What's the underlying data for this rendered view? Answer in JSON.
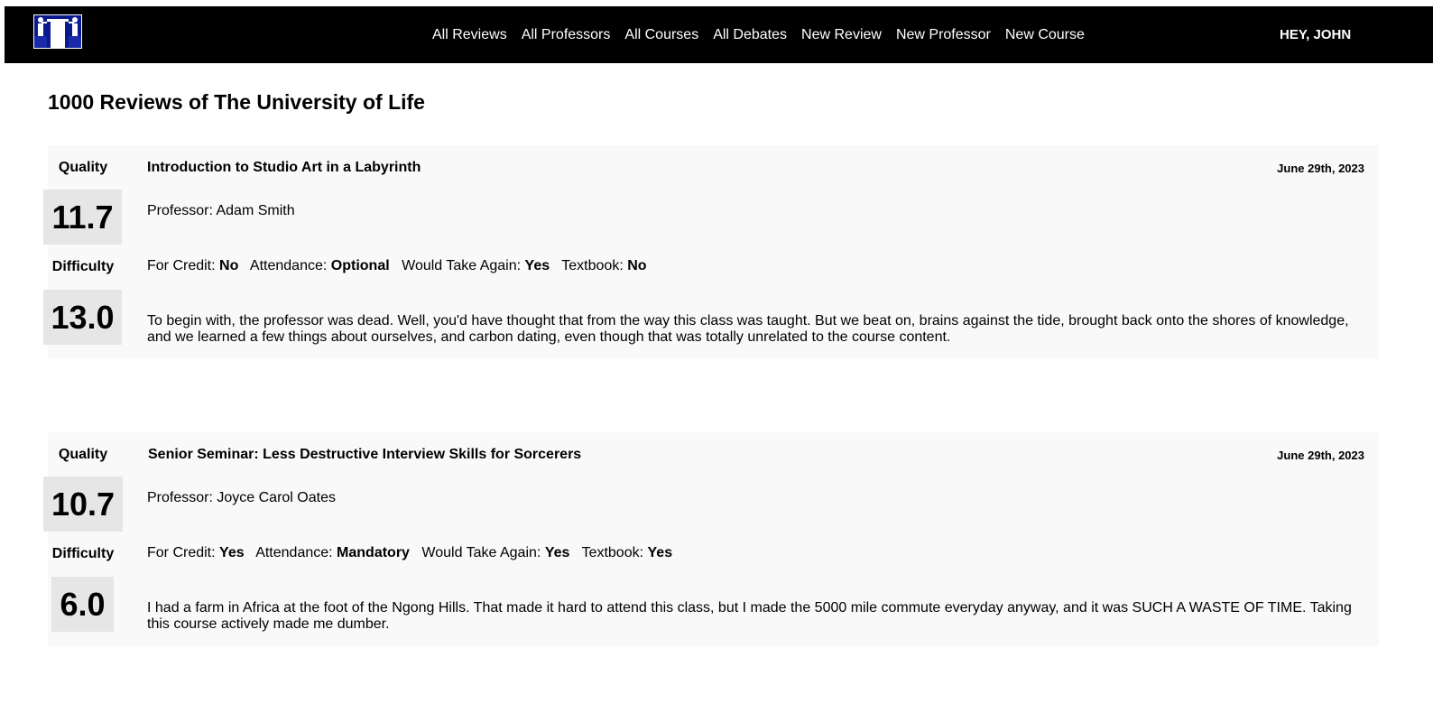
{
  "nav": {
    "logo": "debate-podium-logo-icon",
    "links": [
      "All Reviews",
      "All Professors",
      "All Courses",
      "All Debates",
      "New Review",
      "New Professor",
      "New Course"
    ],
    "greeting": "HEY, JOHN"
  },
  "page": {
    "title": "1000 Reviews of The University of Life"
  },
  "reviews": [
    {
      "quality_label": "Quality",
      "quality": "11.7",
      "difficulty_label": "Difficulty",
      "difficulty": "13.0",
      "course": "Introduction to Studio Art in a Labyrinth",
      "date": "June 29th, 2023",
      "professor_label": "Professor:",
      "professor": "Adam Smith",
      "for_credit_label": "For Credit:",
      "for_credit": "No",
      "attendance_label": "Attendance:",
      "attendance": "Optional",
      "take_again_label": "Would Take Again:",
      "take_again": "Yes",
      "textbook_label": "Textbook:",
      "textbook": "No",
      "comment": "To begin with, the professor was dead. Well, you'd have thought that from the way this class was taught. But we beat on, brains against the tide, brought back onto the shores of knowledge, and we learned a few things about ourselves, and carbon dating, even though that was totally unrelated to the course content."
    },
    {
      "quality_label": "Quality",
      "quality": "10.7",
      "difficulty_label": "Difficulty",
      "difficulty": "6.0",
      "course": "Senior Seminar: Less Destructive Interview Skills for Sorcerers",
      "date": "June 29th, 2023",
      "professor_label": "Professor:",
      "professor": "Joyce Carol Oates",
      "for_credit_label": "For Credit:",
      "for_credit": "Yes",
      "attendance_label": "Attendance:",
      "attendance": "Mandatory",
      "take_again_label": "Would Take Again:",
      "take_again": "Yes",
      "textbook_label": "Textbook:",
      "textbook": "Yes",
      "comment": "I had a farm in Africa at the foot of the Ngong Hills. That made it hard to attend this class, but I made the 5000 mile commute everyday anyway, and it was SUCH A WASTE OF TIME. Taking this course actively made me dumber."
    }
  ],
  "colors": {
    "navbar_bg": "#000000",
    "card_bg": "#f9f9f9",
    "score_bg": "#e6e6e6",
    "logo_blue": "#0a1a8c"
  }
}
